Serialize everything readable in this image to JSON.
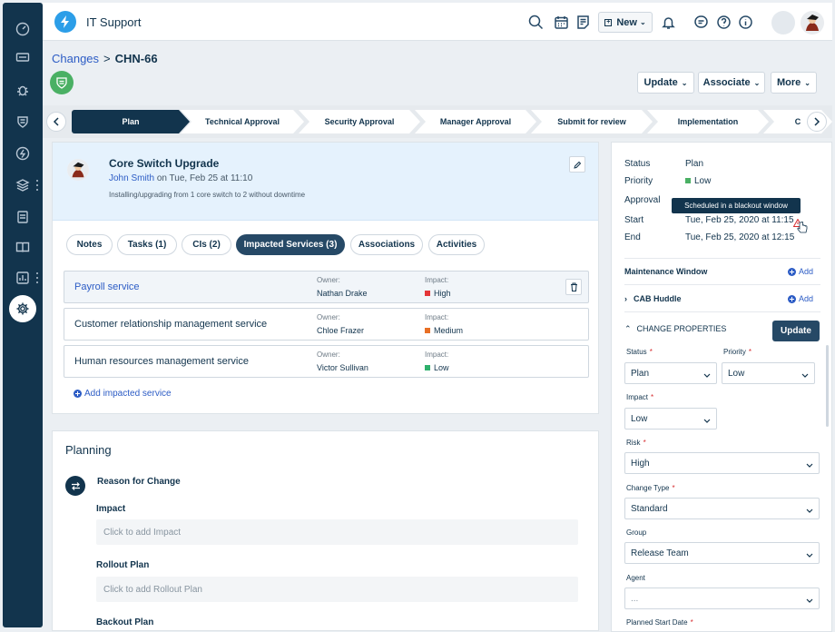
{
  "app": {
    "title": "IT Support",
    "new_label": "New"
  },
  "breadcrumb": {
    "link": "Changes",
    "sep": ">",
    "current": "CHN-66"
  },
  "header_actions": {
    "update": "Update",
    "associate": "Associate",
    "more": "More"
  },
  "steps": [
    "Plan",
    "Technical Approval",
    "Security Approval",
    "Manager Approval",
    "Submit for review",
    "Implementation",
    "C"
  ],
  "change": {
    "title": "Core Switch Upgrade",
    "requester": "John Smith",
    "date_text": "on Tue, Feb 25 at 11:10",
    "description": "Installing/upgrading from 1 core switch to 2 without downtime"
  },
  "tabs": [
    "Notes",
    "Tasks (1)",
    "CIs (2)",
    "Impacted Services (3)",
    "Associations",
    "Activities"
  ],
  "services": [
    {
      "name": "Payroll service",
      "owner_label": "Owner:",
      "owner": "Nathan Drake",
      "impact_label": "Impact:",
      "impact": "High",
      "impact_color": "#e43538"
    },
    {
      "name": "Customer relationship management service",
      "owner_label": "Owner:",
      "owner": "Chloe Frazer",
      "impact_label": "Impact:",
      "impact": "Medium",
      "impact_color": "#e86f25"
    },
    {
      "name": "Human resources management service",
      "owner_label": "Owner:",
      "owner": "Victor Sullivan",
      "impact_label": "Impact:",
      "impact": "Low",
      "impact_color": "#2fb06c"
    }
  ],
  "add_service": "Add impacted service",
  "planning": {
    "title": "Planning",
    "reason": "Reason for Change",
    "impact_label": "Impact",
    "impact_placeholder": "Click to add Impact",
    "rollout_label": "Rollout Plan",
    "rollout_placeholder": "Click to add Rollout Plan",
    "backout_label": "Backout Plan"
  },
  "summary": {
    "status_label": "Status",
    "status": "Plan",
    "priority_label": "Priority",
    "priority": "Low",
    "priority_color": "#4ab064",
    "approval_label": "Approval",
    "start_label": "Start",
    "start": "Tue, Feb 25, 2020 at 11:15",
    "end_label": "End",
    "end": "Tue, Feb 25, 2020 at 12:15",
    "tooltip": "Scheduled in a blackout window"
  },
  "maintenance": "Maintenance Window",
  "cab": "CAB Huddle",
  "add": "Add",
  "props": {
    "title": "CHANGE PROPERTIES",
    "update": "Update",
    "status_label": "Status",
    "status": "Plan",
    "priority_label": "Priority",
    "priority": "Low",
    "impact_label": "Impact",
    "impact": "Low",
    "risk_label": "Risk",
    "risk": "High",
    "type_label": "Change Type",
    "type": "Standard",
    "group_label": "Group",
    "group": "Release Team",
    "agent_label": "Agent",
    "agent": "...",
    "planned_label": "Planned Start Date",
    "req": "*"
  }
}
